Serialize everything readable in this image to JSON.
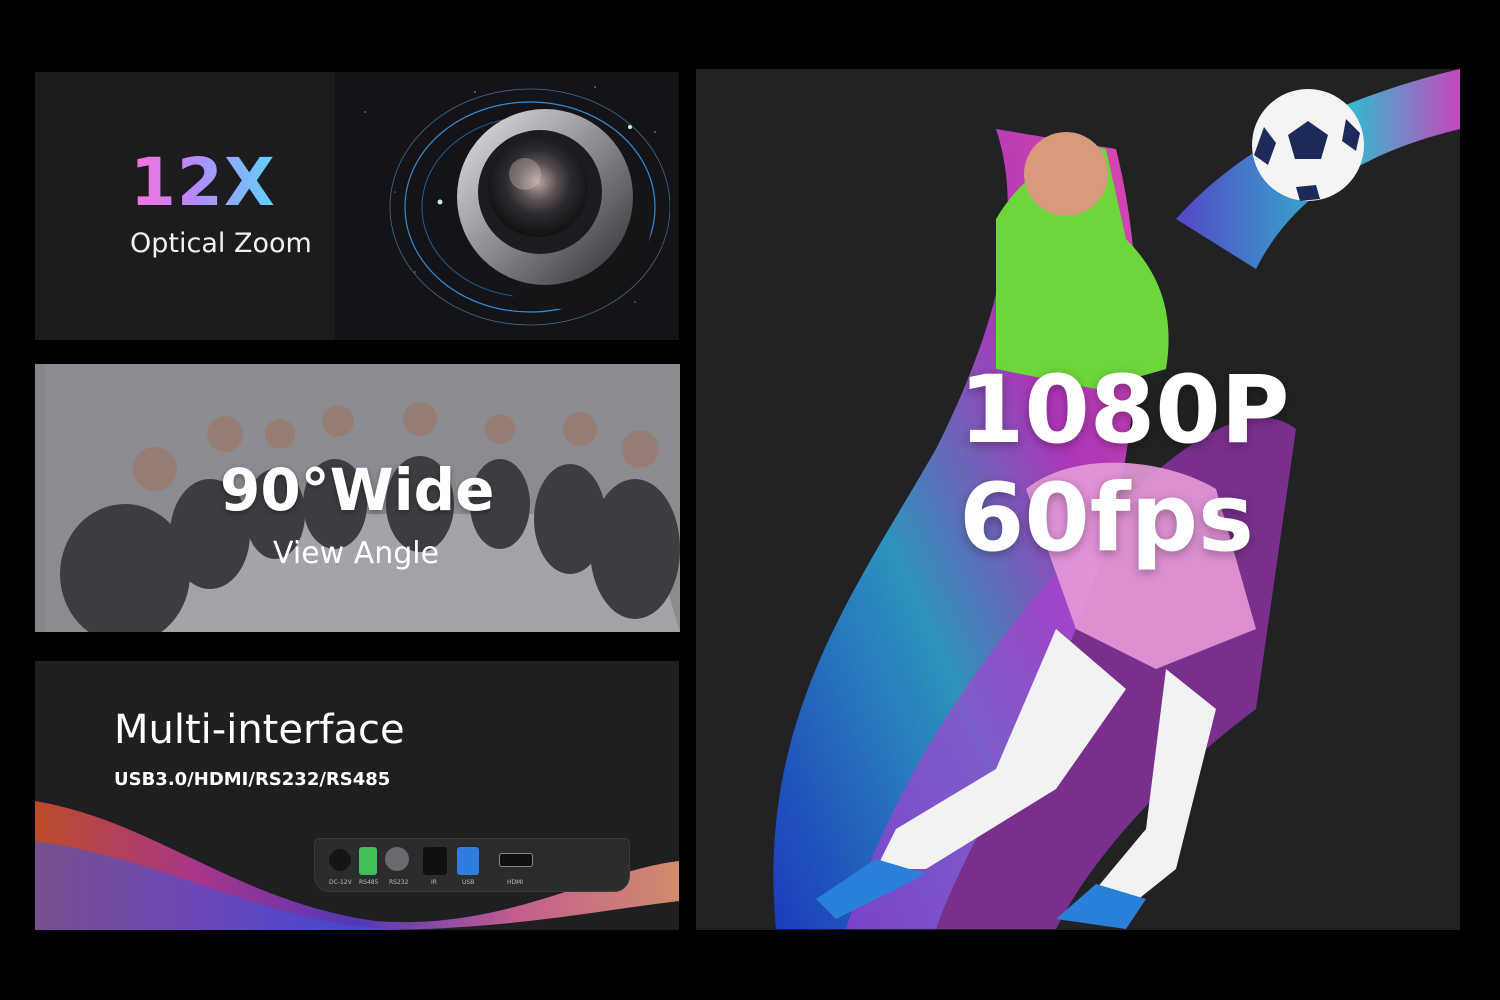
{
  "zoom": {
    "value": "12X",
    "label": "Optical Zoom"
  },
  "wide": {
    "value": "90°Wide",
    "label": "View Angle"
  },
  "interface": {
    "title": "Multi-interface",
    "ports_text": "USB3.0/HDMI/RS232/RS485",
    "port_labels": [
      "DC-12V",
      "RS485",
      "RS232",
      "IR",
      "USB",
      "HDMI"
    ]
  },
  "hero": {
    "line1": "1080P",
    "line2": "60fps"
  },
  "colors": {
    "accent_pink": "#ff6fd8",
    "accent_cyan": "#5fd3ff",
    "usb_blue": "#2f7de0",
    "rs485_green": "#3fbf5a"
  }
}
